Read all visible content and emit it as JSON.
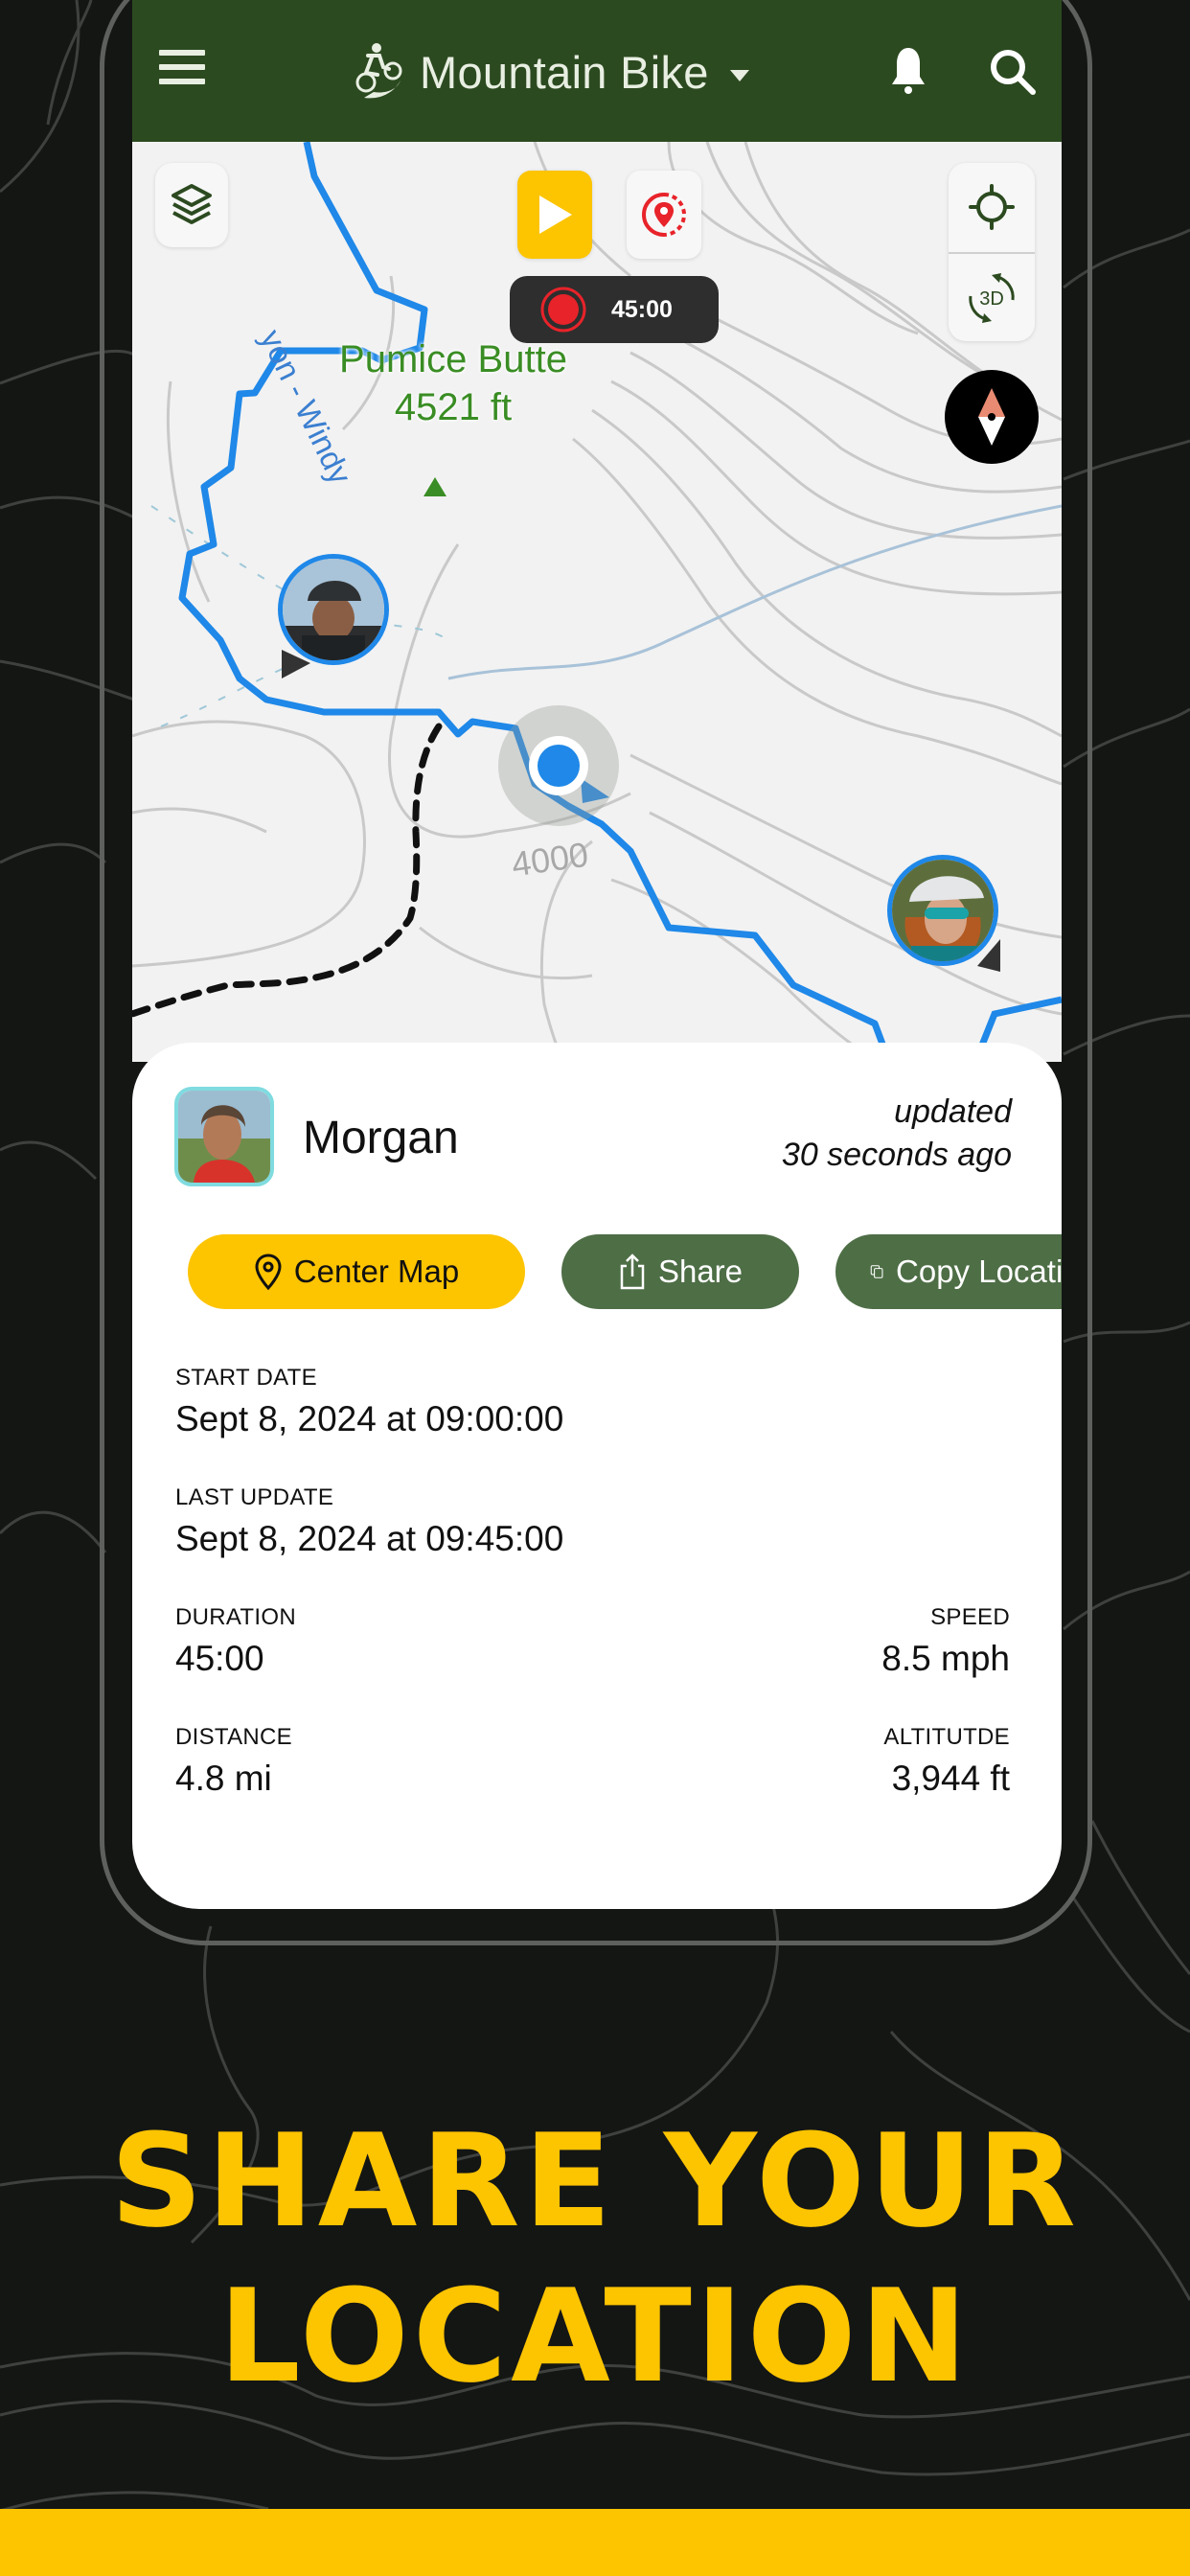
{
  "header": {
    "activity": "Mountain Bike",
    "icons": {
      "menu": "menu-icon",
      "activity": "mountain-biker-icon",
      "dropdown": "caret-down-icon",
      "notifications": "bell-icon",
      "search": "search-icon"
    }
  },
  "map": {
    "trail_label": "yon - Windy",
    "peak_name": "Pumice Butte",
    "peak_elevation": "4521 ft",
    "contour_label": "4000",
    "recording_timer": "45:00",
    "controls": {
      "layers": "layers-icon",
      "play": "play-icon",
      "poi": "map-pin-icon",
      "record": "record-icon",
      "locate": "crosshair-icon",
      "three_d": "3D",
      "compass": "compass-icon"
    },
    "friends": [
      {
        "name": "friend-1",
        "ring_color": "#1f88e8"
      },
      {
        "name": "friend-2",
        "ring_color": "#1f88e8"
      }
    ],
    "colors": {
      "trail": "#1f88e8",
      "unofficial_trail": "#111111",
      "peak_label": "#3a8d24"
    }
  },
  "sheet": {
    "user_name": "Morgan",
    "updated_line1": "updated",
    "updated_line2": "30 seconds ago",
    "actions": [
      {
        "label": "Center Map",
        "icon": "map-pin-outline-icon"
      },
      {
        "label": "Share",
        "icon": "share-icon"
      },
      {
        "label": "Copy Location",
        "visible_label": "Copy Loca",
        "icon": "copy-icon"
      }
    ],
    "stats": {
      "start_date_label": "START DATE",
      "start_date_value": "Sept 8, 2024 at 09:00:00",
      "last_update_label": "LAST UPDATE",
      "last_update_value": "Sept 8, 2024 at 09:45:00",
      "duration_label": "DURATION",
      "duration_value": "45:00",
      "speed_label": "SPEED",
      "speed_value": "8.5 mph",
      "distance_label": "DISTANCE",
      "distance_value": "4.8 mi",
      "altitude_label": "ALTITUTDE",
      "altitude_value": "3,944 ft"
    }
  },
  "promo": {
    "headline_line1": "SHARE YOUR",
    "headline_line2": "LOCATION"
  },
  "colors": {
    "header_green": "#2c4a20",
    "accent_yellow": "#fdc400",
    "button_green": "#4e6e46",
    "background_dark": "#141614"
  }
}
